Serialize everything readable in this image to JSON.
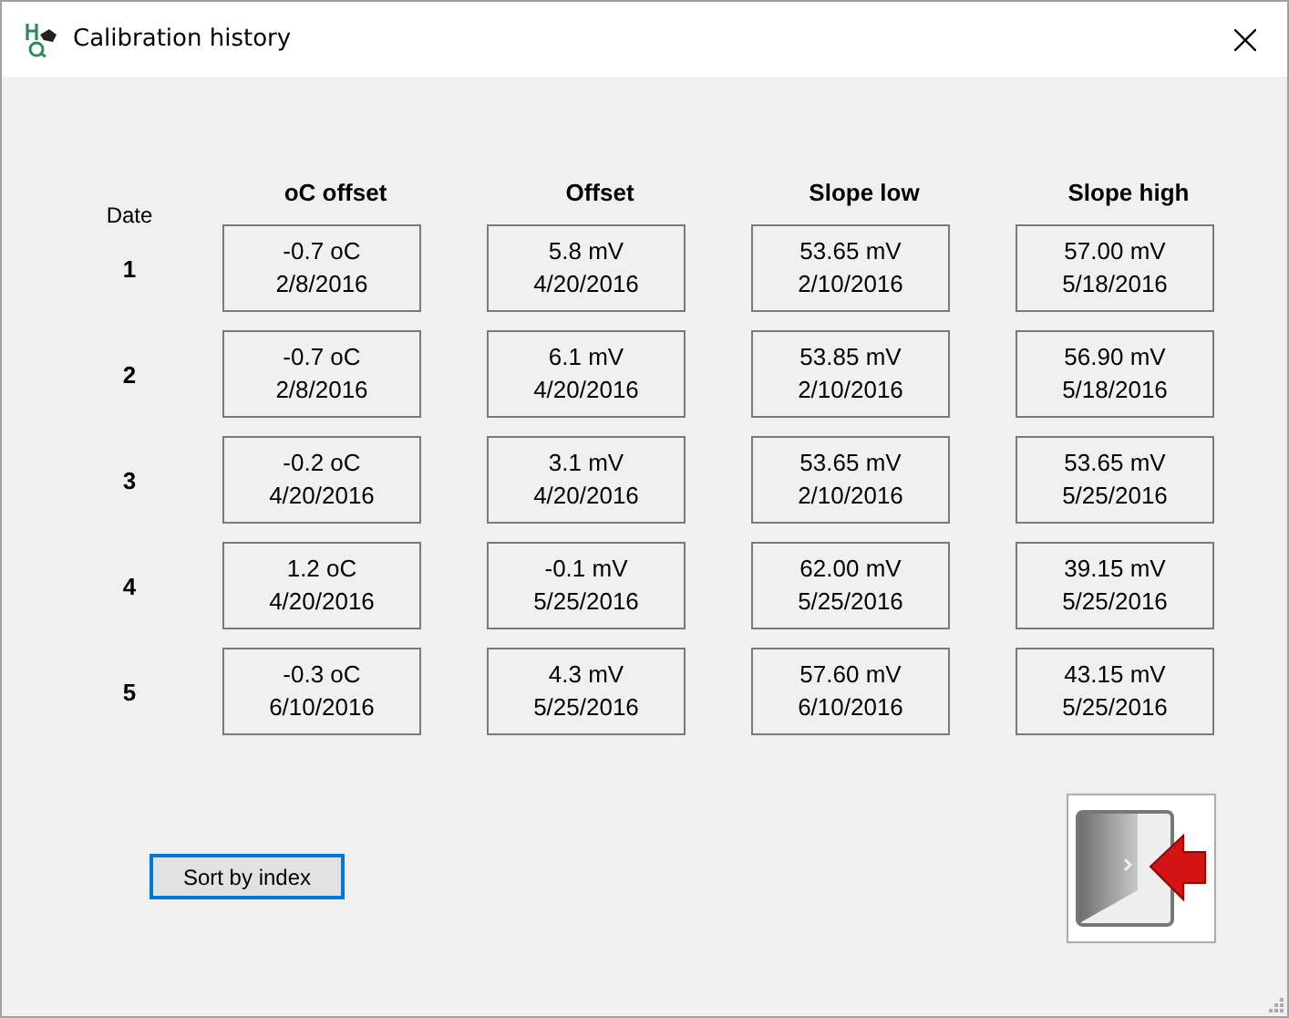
{
  "window": {
    "title": "Calibration history"
  },
  "table": {
    "date_label": "Date",
    "columns": [
      "oC offset",
      "Offset",
      "Slope low",
      "Slope high"
    ],
    "rows": [
      {
        "index": "1",
        "cells": [
          {
            "value": "-0.7 oC",
            "date": "2/8/2016"
          },
          {
            "value": "5.8 mV",
            "date": "4/20/2016"
          },
          {
            "value": "53.65 mV",
            "date": "2/10/2016"
          },
          {
            "value": "57.00 mV",
            "date": "5/18/2016"
          }
        ]
      },
      {
        "index": "2",
        "cells": [
          {
            "value": "-0.7 oC",
            "date": "2/8/2016"
          },
          {
            "value": "6.1 mV",
            "date": "4/20/2016"
          },
          {
            "value": "53.85 mV",
            "date": "2/10/2016"
          },
          {
            "value": "56.90 mV",
            "date": "5/18/2016"
          }
        ]
      },
      {
        "index": "3",
        "cells": [
          {
            "value": "-0.2 oC",
            "date": "4/20/2016"
          },
          {
            "value": "3.1 mV",
            "date": "4/20/2016"
          },
          {
            "value": "53.65 mV",
            "date": "2/10/2016"
          },
          {
            "value": "53.65 mV",
            "date": "5/25/2016"
          }
        ]
      },
      {
        "index": "4",
        "cells": [
          {
            "value": "1.2 oC",
            "date": "4/20/2016"
          },
          {
            "value": "-0.1 mV",
            "date": "5/25/2016"
          },
          {
            "value": "62.00 mV",
            "date": "5/25/2016"
          },
          {
            "value": "39.15 mV",
            "date": "5/25/2016"
          }
        ]
      },
      {
        "index": "5",
        "cells": [
          {
            "value": "-0.3 oC",
            "date": "6/10/2016"
          },
          {
            "value": "4.3 mV",
            "date": "5/25/2016"
          },
          {
            "value": "57.60 mV",
            "date": "6/10/2016"
          },
          {
            "value": "43.15 mV",
            "date": "5/25/2016"
          }
        ]
      }
    ]
  },
  "buttons": {
    "sort": {
      "label": "Sort by index",
      "focused": true
    }
  }
}
